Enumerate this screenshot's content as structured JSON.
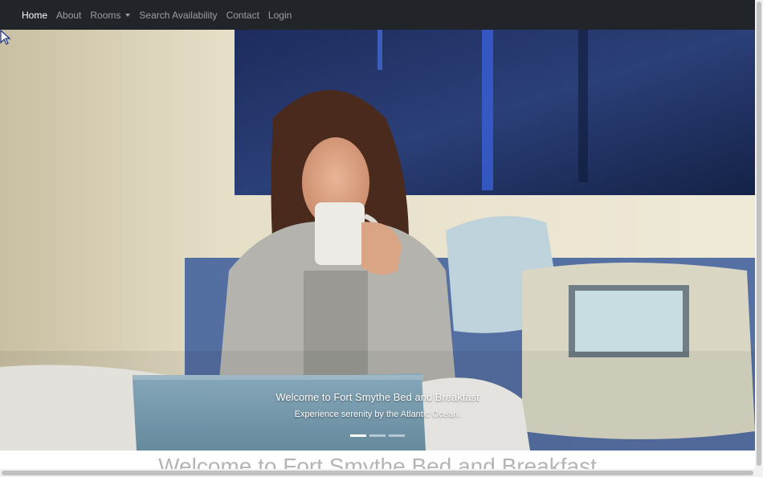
{
  "navbar": {
    "items": [
      {
        "label": "Home",
        "active": true
      },
      {
        "label": "About",
        "active": false
      },
      {
        "label": "Rooms",
        "active": false,
        "dropdown": true
      },
      {
        "label": "Search Availability",
        "active": false
      },
      {
        "label": "Contact",
        "active": false
      },
      {
        "label": "Login",
        "active": false
      }
    ]
  },
  "carousel": {
    "caption_title": "Welcome to Fort Smythe Bed and Breakfast",
    "caption_subtitle": "Experience serenity by the Atlantic Ocean.",
    "indicators": 3,
    "active_index": 0
  },
  "main": {
    "heading_partial": "Welcome to Fort Smythe Bed and Breakfast"
  },
  "colors": {
    "navbar_bg": "#212529",
    "nav_active": "#ffffff",
    "nav_inactive": "rgba(255,255,255,0.55)"
  }
}
